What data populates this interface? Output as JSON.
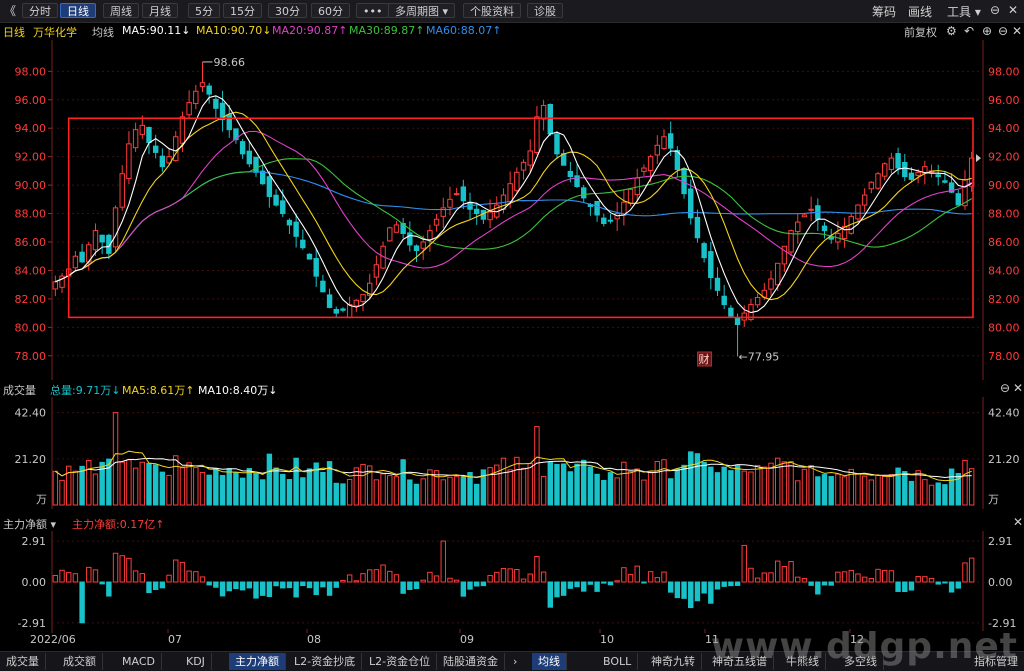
{
  "toolbar": {
    "back_icon": "back-arrow-icon",
    "periods": [
      "分时",
      "日线",
      "周线",
      "月线",
      "5分",
      "15分",
      "30分",
      "60分",
      "•••",
      "多周期图 ▾",
      "个股资料",
      "诊股"
    ],
    "active_period": "日线",
    "right": [
      "筹码",
      "画线",
      "工具 ▾"
    ],
    "window_icons": [
      "settings-icon",
      "minimize-icon",
      "maximize-icon",
      "close-icon"
    ]
  },
  "legend": {
    "period": "日线",
    "stock_name": "万华化学",
    "avg_label": "均线",
    "ma5": "MA5:90.11↓",
    "ma10": "MA10:90.70↓",
    "ma20": "MA20:90.87↑",
    "ma30": "MA30:89.87↑",
    "ma60": "MA60:88.07↑",
    "adjust": "前复权"
  },
  "price_axis": {
    "ticks": [
      "98.00",
      "96.00",
      "94.00",
      "92.00",
      "90.00",
      "88.00",
      "86.00",
      "84.00",
      "82.00",
      "80.00",
      "78.00"
    ],
    "high_label": "98.66",
    "low_label": "←77.95",
    "fin_marker": "财"
  },
  "volume_panel": {
    "title": "成交量",
    "total": "总量:9.71万↓",
    "ma5": "MA5:8.61万↑",
    "ma10": "MA10:8.40万↓",
    "ticks": [
      "42.40",
      "21.20"
    ],
    "unit": "万"
  },
  "flow_panel": {
    "title": "主力净额 ▾",
    "value": "主力净额:0.17亿↑",
    "ticks": [
      "2.91",
      "0.00",
      "-2.91"
    ]
  },
  "x_axis": {
    "labels": [
      "2022/06",
      "07",
      "08",
      "09",
      "10",
      "11",
      "12"
    ]
  },
  "bottom_tabs_left": [
    "成交量",
    "成交额",
    "MACD",
    "KDJ",
    "主力净额",
    "L2-资金抄底",
    "L2-资金仓位",
    "陆股通资金"
  ],
  "bottom_tabs_right": [
    "均线",
    "BOLL",
    "神奇九转",
    "神奇五线谱",
    "牛熊线",
    "多空线",
    "指标管理"
  ],
  "active_bottom_left": "主力净额",
  "active_bottom_right": "均线",
  "watermark": "www.ddgp.net",
  "colors": {
    "up": "#ff3b3b",
    "down": "#19c2c9",
    "ma5": "#ffffff",
    "ma10": "#f2d21b",
    "ma20": "#e040c8",
    "ma30": "#3cc23c",
    "ma60": "#2f8ff0"
  },
  "chart_data": {
    "type": "candlestick",
    "x_range": [
      "2022/06",
      "2022/12"
    ],
    "price_ylim": [
      77.0,
      99.5
    ],
    "highest": 98.66,
    "lowest": 77.95,
    "close_series_approx": [
      83.2,
      83.6,
      84.1,
      85.0,
      84.6,
      85.8,
      86.8,
      86.0,
      85.2,
      88.4,
      90.8,
      92.9,
      93.9,
      94.2,
      93.0,
      92.3,
      91.3,
      92.0,
      93.4,
      94.8,
      95.8,
      96.6,
      97.2,
      96.4,
      95.4,
      94.6,
      93.9,
      93.2,
      92.2,
      91.5,
      90.9,
      90.1,
      89.2,
      88.6,
      88.0,
      87.2,
      86.4,
      85.6,
      84.8,
      83.6,
      82.5,
      81.4,
      81.0,
      81.2,
      81.6,
      81.9,
      82.3,
      83.1,
      84.4,
      85.7,
      87.0,
      87.2,
      86.6,
      85.8,
      85.4,
      86.0,
      86.8,
      87.6,
      88.4,
      89.0,
      89.4,
      88.9,
      88.3,
      88.0,
      87.6,
      88.1,
      88.6,
      89.3,
      90.1,
      90.9,
      91.6,
      92.4,
      94.8,
      95.6,
      93.6,
      92.2,
      91.4,
      90.6,
      89.9,
      89.1,
      88.5,
      87.9,
      87.3,
      87.5,
      88.0,
      88.8,
      89.7,
      90.5,
      91.2,
      92.0,
      92.8,
      93.4,
      92.6,
      91.1,
      89.4,
      87.7,
      86.3,
      84.9,
      83.5,
      82.6,
      81.6,
      80.8,
      80.2,
      81.0,
      81.6,
      82.1,
      82.6,
      83.4,
      84.5,
      85.7,
      86.8,
      87.4,
      87.9,
      88.3,
      87.6,
      86.8,
      86.2,
      86.6,
      87.1,
      87.8,
      88.6,
      89.3,
      90.2,
      90.8,
      91.5,
      91.9,
      91.2,
      90.6,
      90.4,
      90.9,
      91.3,
      91.0,
      90.6,
      90.2,
      89.5,
      88.6,
      90.4,
      91.9
    ],
    "volume_ylim": [
      0,
      45
    ],
    "volume_unit": "万",
    "flow_ylim": [
      -3.2,
      3.2
    ],
    "flow_unit": "亿",
    "box_range": [
      80.7,
      94.7
    ]
  }
}
